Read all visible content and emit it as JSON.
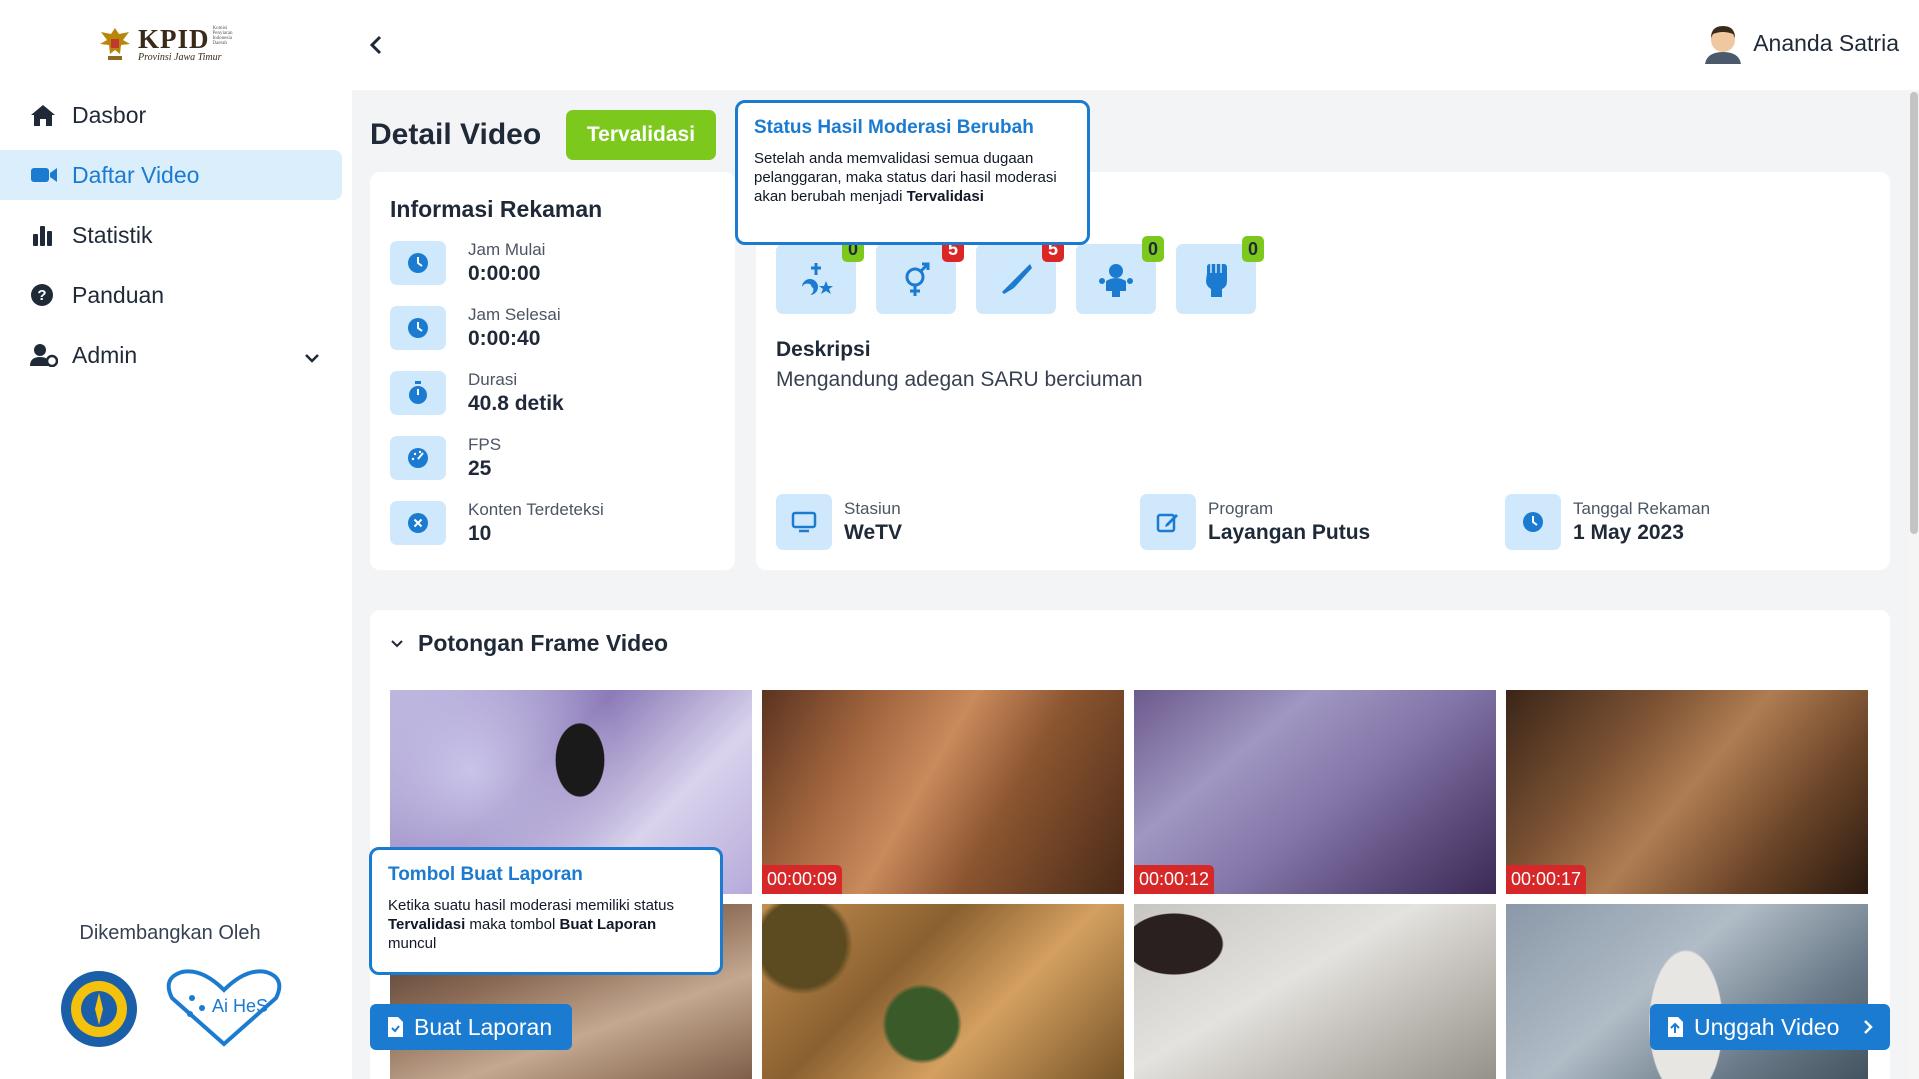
{
  "app": {
    "logo_text": "KPID",
    "logo_subtext": "Provinsi Jawa Timur",
    "logo_small": "Komisi Penyiaran Indonesia Daerah"
  },
  "sidebar": {
    "items": [
      {
        "label": "Dasbor",
        "icon": "home-icon"
      },
      {
        "label": "Daftar Video",
        "icon": "video-camera-icon",
        "active": true
      },
      {
        "label": "Statistik",
        "icon": "bar-chart-icon"
      },
      {
        "label": "Panduan",
        "icon": "question-circle-icon"
      },
      {
        "label": "Admin",
        "icon": "user-gear-icon"
      }
    ],
    "developed_by": "Dikembangkan Oleh",
    "partner_logo_text": "Ai HeS"
  },
  "header": {
    "user_name": "Ananda Satria"
  },
  "page": {
    "title": "Detail Video",
    "status": "Tervalidasi"
  },
  "recording_info": {
    "title": "Informasi Rekaman",
    "rows": [
      {
        "label": "Jam Mulai",
        "value": "0:00:00",
        "icon": "clock-icon"
      },
      {
        "label": "Jam Selesai",
        "value": "0:00:40",
        "icon": "clock-icon"
      },
      {
        "label": "Durasi",
        "value": "40.8 detik",
        "icon": "stopwatch-icon"
      },
      {
        "label": "FPS",
        "value": "25",
        "icon": "gauge-icon"
      },
      {
        "label": "Konten Terdeteksi",
        "value": "10",
        "icon": "x-circle-icon"
      }
    ]
  },
  "violations": [
    {
      "icon": "religion-icon",
      "count": "0",
      "status": "green"
    },
    {
      "icon": "gender-icon",
      "count": "5",
      "status": "red"
    },
    {
      "icon": "knife-icon",
      "count": "5",
      "status": "red"
    },
    {
      "icon": "child-icon",
      "count": "0",
      "status": "green"
    },
    {
      "icon": "fist-icon",
      "count": "0",
      "status": "green"
    }
  ],
  "description": {
    "label": "Deskripsi",
    "text": "Mengandung adegan SARU berciuman"
  },
  "meta": {
    "station_label": "Stasiun",
    "station_value": "WeTV",
    "program_label": "Program",
    "program_value": "Layangan Putus",
    "date_label": "Tanggal Rekaman",
    "date_value": "1 May 2023"
  },
  "frames": {
    "title": "Potongan Frame Video",
    "items": [
      {
        "time": ""
      },
      {
        "time": "00:00:09"
      },
      {
        "time": "00:00:12"
      },
      {
        "time": "00:00:17"
      },
      {
        "time": ""
      },
      {
        "time": ""
      },
      {
        "time": ""
      },
      {
        "time": ""
      }
    ]
  },
  "buttons": {
    "report": "Buat Laporan",
    "upload": "Unggah Video"
  },
  "tooltips": {
    "status_title": "Status Hasil Moderasi Berubah",
    "status_body_1": "Setelah anda memvalidasi semua dugaan pelanggaran, maka status dari hasil moderasi akan berubah menjadi ",
    "status_body_bold": "Tervalidasi",
    "report_title": "Tombol Buat Laporan",
    "report_body_1": "Ketika suatu hasil moderasi memiliki status ",
    "report_body_bold_1": "Tervalidasi",
    "report_body_2": " maka tombol ",
    "report_body_bold_2": "Buat Laporan",
    "report_body_3": " muncul"
  },
  "colors": {
    "primary": "#1b7bd0",
    "validated": "#7cc81d",
    "danger": "#dc2626",
    "icon_bg": "#cfe8fb",
    "active_nav_bg": "#dbeefb"
  }
}
